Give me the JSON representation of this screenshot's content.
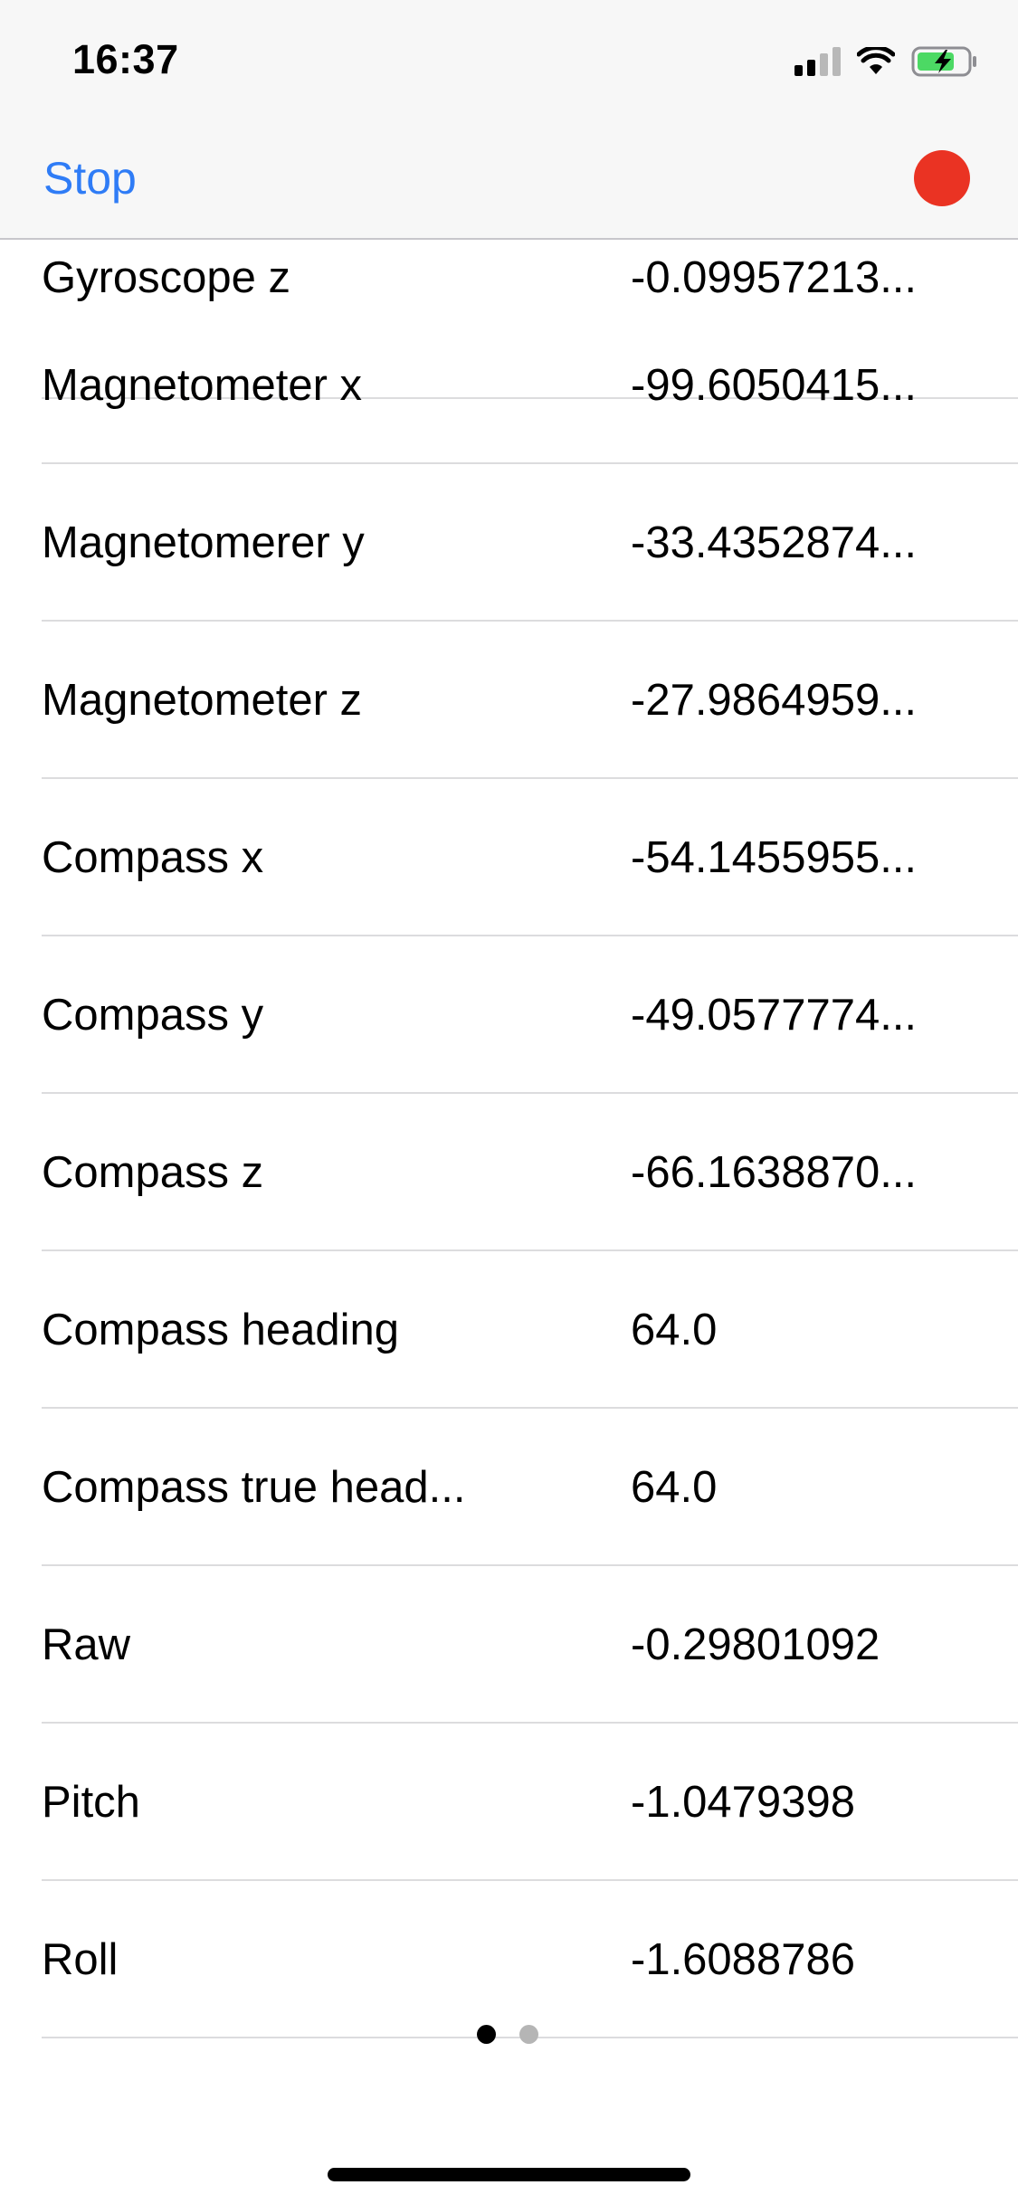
{
  "status_bar": {
    "time": "16:37",
    "icons": [
      "cellular-signal-icon",
      "wifi-icon",
      "battery-charging-icon"
    ]
  },
  "nav": {
    "stop_label": "Stop",
    "record_color": "#ea3323",
    "accent_color": "#2f7cf6"
  },
  "rows": [
    {
      "label": "Gyroscope z",
      "value": "-0.09957213..."
    },
    {
      "label": "Magnetometer x",
      "value": "-99.6050415..."
    },
    {
      "label": "Magnetomerer y",
      "value": "-33.4352874..."
    },
    {
      "label": "Magnetometer z",
      "value": "-27.9864959..."
    },
    {
      "label": "Compass x",
      "value": "-54.1455955..."
    },
    {
      "label": "Compass y",
      "value": "-49.0577774..."
    },
    {
      "label": "Compass z",
      "value": "-66.1638870..."
    },
    {
      "label": "Compass heading",
      "value": "64.0"
    },
    {
      "label": "Compass true head...",
      "value": "64.0"
    },
    {
      "label": "Raw",
      "value": "-0.29801092"
    },
    {
      "label": "Pitch",
      "value": "-1.0479398"
    },
    {
      "label": "Roll",
      "value": "-1.6088786"
    }
  ],
  "page_indicator": {
    "current_page": 1,
    "total_pages": 2
  }
}
